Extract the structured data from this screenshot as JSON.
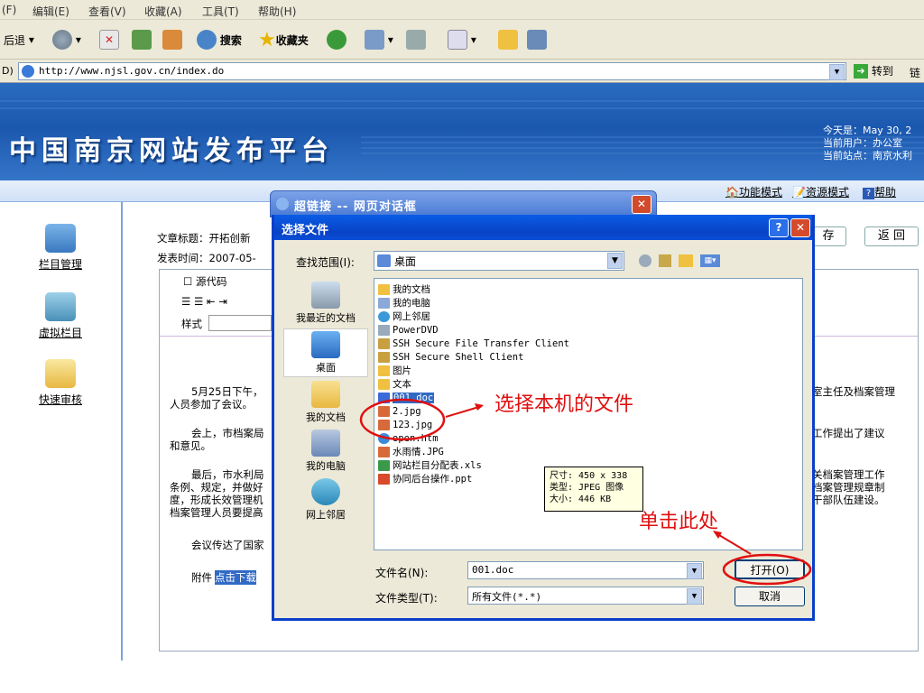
{
  "browser": {
    "menu": [
      "(F)",
      "编辑(E)",
      "查看(V)",
      "收藏(A)",
      "工具(T)",
      "帮助(H)"
    ],
    "toolbar": {
      "back": "后退",
      "search": "搜索",
      "favorites": "收藏夹"
    },
    "address_label": "D)",
    "url": "http://www.njsl.gov.cn/index.do",
    "go": "转到",
    "links": "链"
  },
  "site": {
    "title": "中国南京网站发布平台",
    "info": [
      "今天是：May 30, 2",
      "当前用户：办公室",
      "当前站点：南京水利"
    ],
    "nav": [
      "功能模式",
      "资源模式",
      "帮助"
    ]
  },
  "sidebar": [
    "栏目管理",
    "虚拟栏目",
    "快速审核"
  ],
  "editor": {
    "title_label": "文章标题：开拓创新",
    "date_label": "发表时间：2007-05-",
    "source_code": "源代码",
    "style_label": "样式",
    "save": "存",
    "back": "返 回",
    "lines": [
      "5月25日下午，",
      "室主任及档案管理",
      "人员参加了会议。",
      "会上，市档案局",
      "工作提出了建议",
      "和意见。",
      "最后，市水利局",
      "关档案管理工作",
      "条例、规定，并做好",
      "档案管理规章制",
      "度，形成长效管理机",
      "干部队伍建设。",
      "档案管理人员要提高",
      "会议传达了国家",
      "附件",
      "点击下载"
    ]
  },
  "outer_dialog": {
    "title": "超链接 -- 网页对话框"
  },
  "dialog": {
    "title": "选择文件",
    "look_in_label": "查找范围(I):",
    "look_in_value": "桌面",
    "places": [
      "我最近的文档",
      "桌面",
      "我的文档",
      "我的电脑",
      "网上邻居"
    ],
    "files": [
      "我的文档",
      "我的电脑",
      "网上邻居",
      "PowerDVD",
      "SSH Secure File Transfer Client",
      "SSH Secure Shell Client",
      "图片",
      "文本",
      "001.doc",
      "2.jpg",
      "123.jpg",
      "open.htm",
      "水雨情.JPG",
      "网站栏目分配表.xls",
      "协同后台操作.ppt"
    ],
    "tooltip": [
      "尺寸: 450 x 338",
      "类型: JPEG 图像",
      "大小: 446 KB"
    ],
    "filename_label": "文件名(N):",
    "filename_value": "001.doc",
    "filetype_label": "文件类型(T):",
    "filetype_value": "所有文件(*.*)",
    "open_button": "打开(O)",
    "cancel_button": "取消"
  },
  "annotations": {
    "select_file": "选择本机的文件",
    "click_here": "单击此处"
  },
  "colors": {
    "annotation": "#e01010",
    "header_blue": "#1b57ae",
    "dialog_title": "#0843c5"
  }
}
